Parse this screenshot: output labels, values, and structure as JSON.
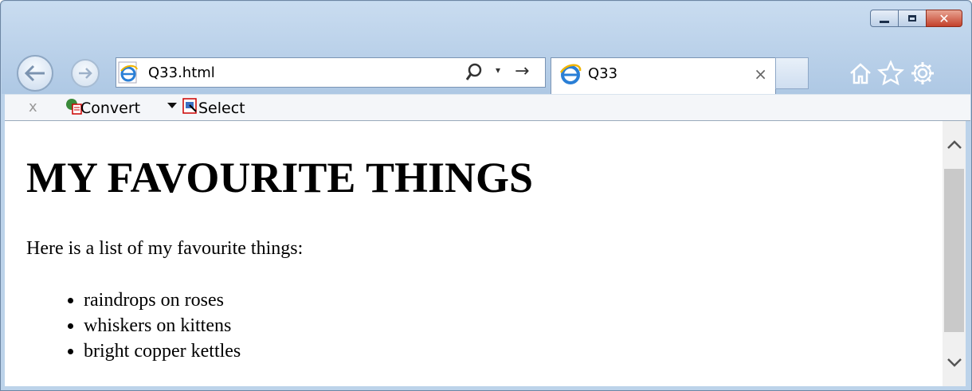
{
  "window": {
    "buttons": {
      "minimize": "minimize",
      "maximize": "maximize",
      "close": "✕"
    }
  },
  "nav": {
    "address_value": "Q33.html",
    "go_glyph": "→",
    "drop_glyph": "▾"
  },
  "tab": {
    "title": "Q33",
    "close_glyph": "×"
  },
  "commandbar": {
    "close_glyph": "x",
    "convert_label": "Convert",
    "select_label": "Select"
  },
  "page": {
    "heading": "MY FAVOURITE THINGS",
    "intro": "Here is a list of my favourite things:",
    "items": [
      "raindrops on roses",
      "whiskers on kittens",
      "bright copper kettles"
    ]
  },
  "icons": [
    "back-arrow-icon",
    "forward-arrow-icon",
    "ie-logo-icon",
    "search-icon",
    "home-icon",
    "star-icon",
    "gear-icon",
    "convert-icon",
    "select-icon"
  ]
}
